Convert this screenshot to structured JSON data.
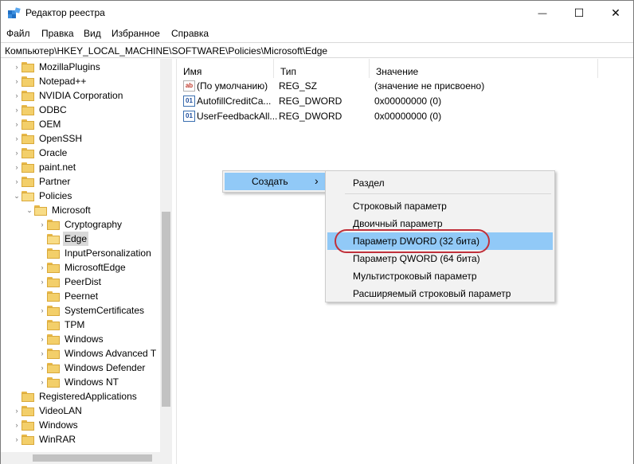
{
  "window": {
    "title": "Редактор реестра",
    "controls": {
      "minimize": "—",
      "maximize": "☐",
      "close": "✕"
    }
  },
  "menu": [
    "Файл",
    "Правка",
    "Вид",
    "Избранное",
    "Справка"
  ],
  "address": "Компьютер\\HKEY_LOCAL_MACHINE\\SOFTWARE\\Policies\\Microsoft\\Edge",
  "tree": [
    {
      "label": "MozillaPlugins",
      "level": 0,
      "chevron": "›"
    },
    {
      "label": "Notepad++",
      "level": 0,
      "chevron": "›"
    },
    {
      "label": "NVIDIA Corporation",
      "level": 0,
      "chevron": "›"
    },
    {
      "label": "ODBC",
      "level": 0,
      "chevron": "›"
    },
    {
      "label": "OEM",
      "level": 0,
      "chevron": "›"
    },
    {
      "label": "OpenSSH",
      "level": 0,
      "chevron": "›"
    },
    {
      "label": "Oracle",
      "level": 0,
      "chevron": "›"
    },
    {
      "label": "paint.net",
      "level": 0,
      "chevron": "›"
    },
    {
      "label": "Partner",
      "level": 0,
      "chevron": "›"
    },
    {
      "label": "Policies",
      "level": 0,
      "chevron": "⌄",
      "open": true
    },
    {
      "label": "Microsoft",
      "level": 1,
      "chevron": "⌄",
      "open": true
    },
    {
      "label": "Cryptography",
      "level": 2,
      "chevron": "›"
    },
    {
      "label": "Edge",
      "level": 2,
      "chevron": "",
      "selected": true,
      "open": true
    },
    {
      "label": "InputPersonalization",
      "level": 2,
      "chevron": ""
    },
    {
      "label": "MicrosoftEdge",
      "level": 2,
      "chevron": "›"
    },
    {
      "label": "PeerDist",
      "level": 2,
      "chevron": "›"
    },
    {
      "label": "Peernet",
      "level": 2,
      "chevron": ""
    },
    {
      "label": "SystemCertificates",
      "level": 2,
      "chevron": "›"
    },
    {
      "label": "TPM",
      "level": 2,
      "chevron": ""
    },
    {
      "label": "Windows",
      "level": 2,
      "chevron": "›"
    },
    {
      "label": "Windows Advanced T",
      "level": 2,
      "chevron": "›"
    },
    {
      "label": "Windows Defender",
      "level": 2,
      "chevron": "›"
    },
    {
      "label": "Windows NT",
      "level": 2,
      "chevron": "›"
    },
    {
      "label": "RegisteredApplications",
      "level": 0,
      "chevron": ""
    },
    {
      "label": "VideoLAN",
      "level": 0,
      "chevron": "›"
    },
    {
      "label": "Windows",
      "level": 0,
      "chevron": "›"
    },
    {
      "label": "WinRAR",
      "level": 0,
      "chevron": "›"
    }
  ],
  "columns": [
    "Имя",
    "Тип",
    "Значение"
  ],
  "values": [
    {
      "icon": "string-value-icon",
      "icon_text": "ab",
      "name": "(По умолчанию)",
      "type": "REG_SZ",
      "data": "(значение не присвоено)"
    },
    {
      "icon": "binary-value-icon",
      "icon_text": "01",
      "name": "AutofillCreditCa...",
      "type": "REG_DWORD",
      "data": "0x00000000 (0)"
    },
    {
      "icon": "binary-value-icon",
      "icon_text": "01",
      "name": "UserFeedbackAll...",
      "type": "REG_DWORD",
      "data": "0x00000000 (0)"
    }
  ],
  "context_menu": {
    "item": "Создать",
    "arrow": "›"
  },
  "submenu": {
    "items": [
      "Раздел",
      "Строковый параметр",
      "Двоичный параметр",
      "Параметр DWORD (32 бита)",
      "Параметр QWORD (64 бита)",
      "Мультистроковый параметр",
      "Расширяемый строковый параметр"
    ],
    "highlighted_index": 3
  },
  "colors": {
    "highlight": "#91c9f7",
    "annotation": "#c0303a",
    "selection": "#d9d9d9"
  }
}
